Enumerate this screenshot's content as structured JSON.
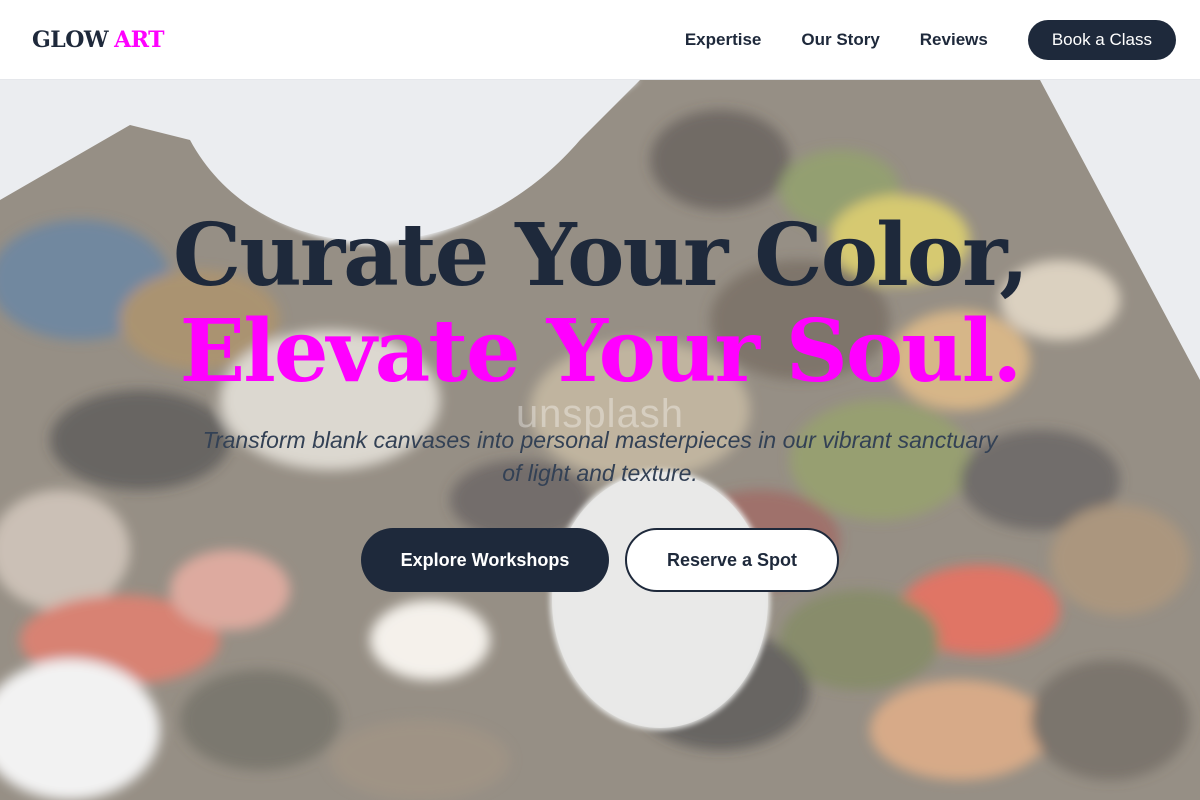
{
  "header": {
    "logo_part1": "GLOW",
    "logo_part2": "ART",
    "nav": [
      "Expertise",
      "Our Story",
      "Reviews"
    ],
    "cta": "Book a Class"
  },
  "hero": {
    "headline_line1": "Curate Your Color,",
    "headline_line2": "Elevate Your Soul.",
    "watermark": "unsplash",
    "subtitle": "Transform blank canvases into personal masterpieces in our vibrant sanctuary of light and texture.",
    "primary_button": "Explore Workshops",
    "secondary_button": "Reserve a Spot"
  },
  "colors": {
    "brand_navy": "#1e293b",
    "accent_magenta": "#ff00ff",
    "header_bg": "#ffffff"
  }
}
